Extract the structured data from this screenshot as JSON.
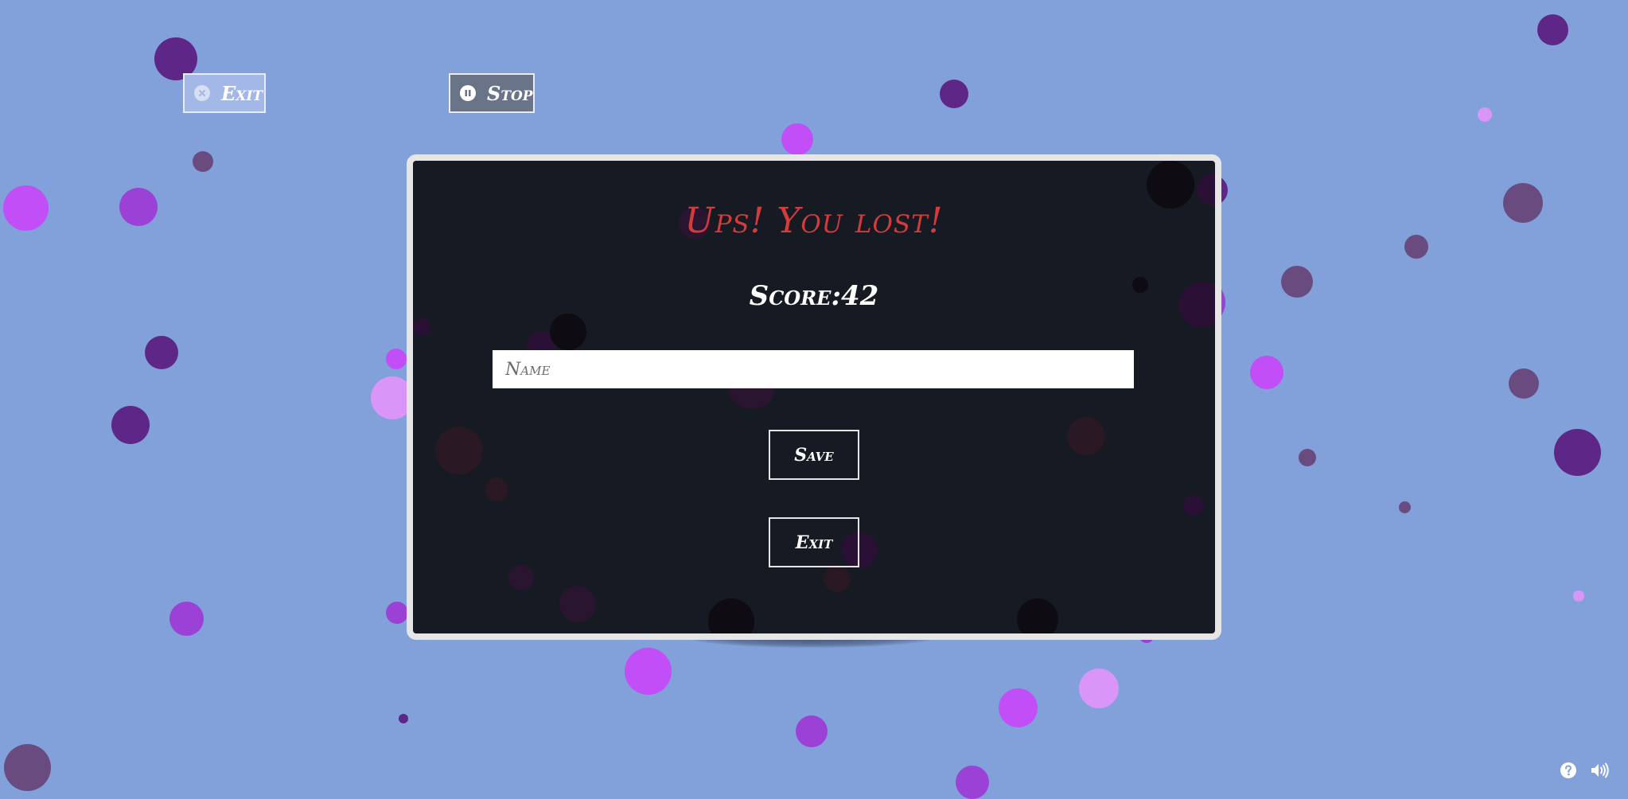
{
  "toolbar": {
    "exit_label": "Exit",
    "stop_label": "Stop"
  },
  "dialog": {
    "title": "Ups! You lost!",
    "score_label": "Score:",
    "score_value": "42",
    "name_placeholder": "Name",
    "name_value": "",
    "save_label": "Save",
    "exit_label": "Exit"
  },
  "icons": {
    "exit_icon": "close-circle-icon",
    "stop_icon": "pause-circle-icon",
    "help_icon": "help-circle-icon",
    "sound_icon": "volume-icon"
  },
  "colors": {
    "background": "#82a0da",
    "dialog_bg": "#161a22",
    "title": "#d63b3b",
    "bubble_dark_purple": "#5e2687",
    "bubble_violet": "#9b41d6",
    "bubble_magenta": "#c14ef7",
    "bubble_light_pink": "#d996f8",
    "bubble_mauve": "#6a4b7f"
  }
}
